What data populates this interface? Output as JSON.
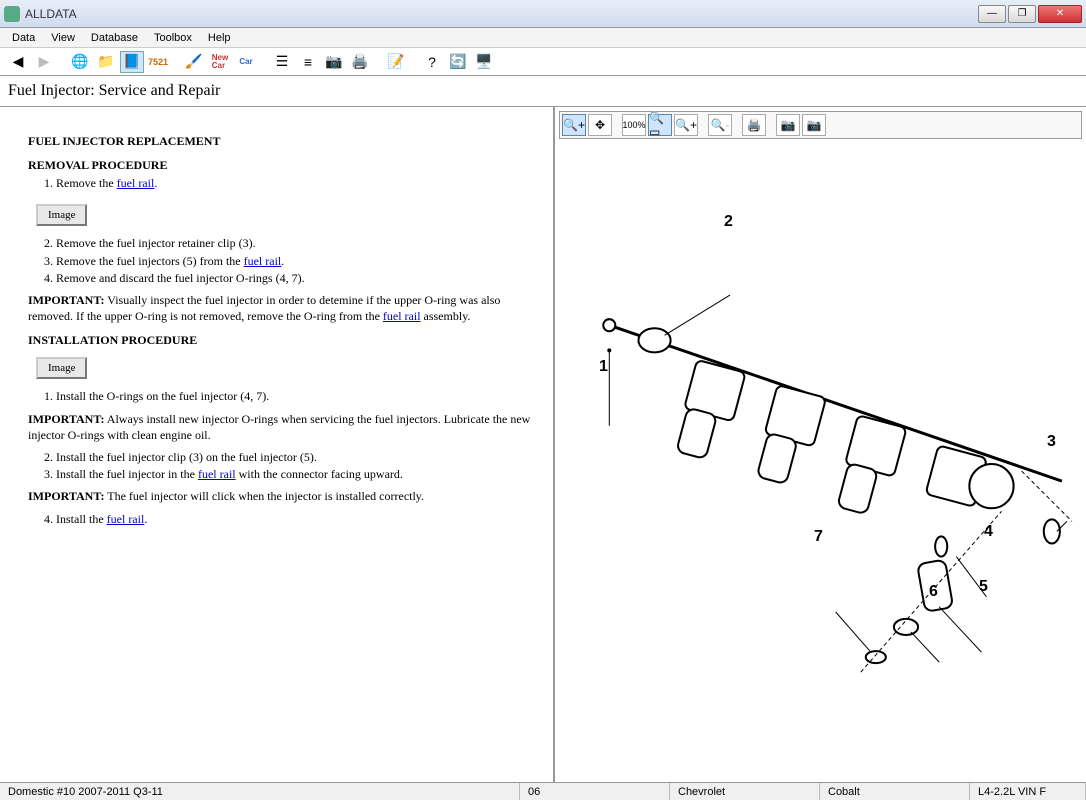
{
  "window": {
    "title": "ALLDATA"
  },
  "menu": [
    "Data",
    "View",
    "Database",
    "Toolbox",
    "Help"
  ],
  "page": {
    "title": "Fuel Injector:  Service and Repair"
  },
  "doc": {
    "h1": "FUEL INJECTOR REPLACEMENT",
    "removal_h": "REMOVAL PROCEDURE",
    "rem1_a": "Remove the ",
    "rem1_link": "fuel rail",
    "rem1_b": ".",
    "imgbtn": "Image",
    "rem2": "Remove the fuel injector retainer clip (3).",
    "rem3_a": "Remove the fuel injectors (5) from the ",
    "rem3_link": "fuel rail",
    "rem3_b": ".",
    "rem4": "Remove and discard the fuel injector O-rings (4, 7).",
    "imp1_label": "IMPORTANT:",
    "imp1_text_a": "  Visually inspect the fuel injector in order to detemine if the upper O-ring was also removed. If the upper O-ring is not removed, remove the O-ring from the ",
    "imp1_link": "fuel rail",
    "imp1_text_b": " assembly.",
    "install_h": "INSTALLATION PROCEDURE",
    "ins1": "Install the O-rings on the fuel injector (4, 7).",
    "imp2_label": "IMPORTANT:",
    "imp2_text": "  Always install new injector O-rings when servicing the fuel injectors. Lubricate the new injector O-rings with clean engine oil.",
    "ins2": "Install the fuel injector clip (3) on the fuel injector (5).",
    "ins3_a": "Install the fuel injector in the ",
    "ins3_link": "fuel rail",
    "ins3_b": " with the connector facing upward.",
    "imp3_label": "IMPORTANT:",
    "imp3_text": "  The fuel injector will click when the injector is installed correctly.",
    "ins4_a": "Install the ",
    "ins4_link": "fuel rail",
    "ins4_b": "."
  },
  "diagram": {
    "labels": {
      "n1": "1",
      "n2": "2",
      "n3": "3",
      "n4": "4",
      "n5": "5",
      "n6": "6",
      "n7": "7"
    }
  },
  "status": {
    "source": "Domestic #10 2007-2011 Q3-11",
    "year": "06",
    "make": "Chevrolet",
    "model": "Cobalt",
    "engine": "L4-2.2L VIN F"
  }
}
